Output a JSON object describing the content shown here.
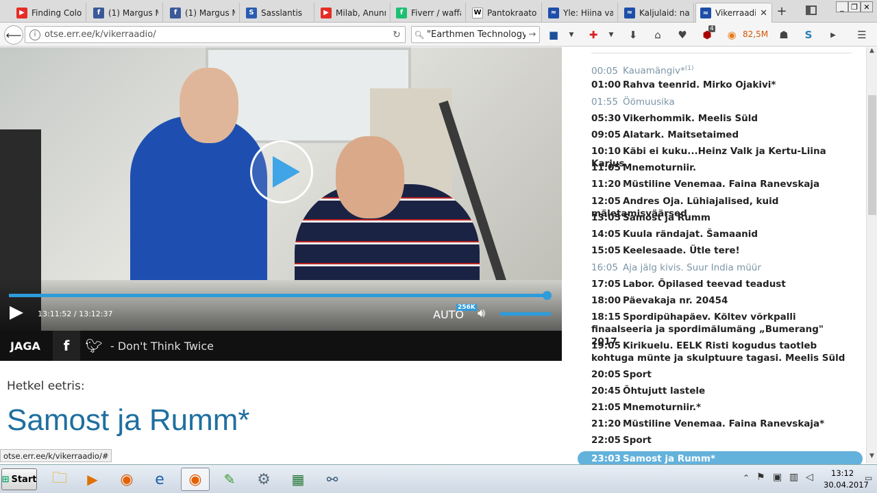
{
  "browser": {
    "tabs": [
      {
        "title": "Finding Colo",
        "fav_color": "#e52d27",
        "fav_glyph": "▶"
      },
      {
        "title": "(1) Margus M",
        "fav_color": "#3b5998",
        "fav_glyph": "f"
      },
      {
        "title": "(1) Margus M",
        "fav_color": "#3b5998",
        "fav_glyph": "f"
      },
      {
        "title": "Sasslantis",
        "fav_color": "#2a5db0",
        "fav_glyph": "S"
      },
      {
        "title": "Milab, Anunn",
        "fav_color": "#e52d27",
        "fav_glyph": "▶"
      },
      {
        "title": "Fiverr / waffa",
        "fav_color": "#1dbf73",
        "fav_glyph": "f"
      },
      {
        "title": "Pantokraator",
        "fav_color": "#ffffff",
        "fav_glyph": "W"
      },
      {
        "title": "Yle: Hiina val",
        "fav_color": "#1d4ea8",
        "fav_glyph": "≈"
      },
      {
        "title": "Kaljulaid: nai",
        "fav_color": "#1d4ea8",
        "fav_glyph": "≈"
      },
      {
        "title": "Vikerraadio",
        "fav_color": "#1d4ea8",
        "fav_glyph": "≈"
      }
    ],
    "new_tab": "+",
    "url": "otse.err.ee/k/vikerraadio/",
    "url_host": "err.ee",
    "search_query": "\"Earthmen Technology\"",
    "memory_badge": "82,5M",
    "addon_badge": "4"
  },
  "player": {
    "play_label": "▶",
    "time": "13:11:52 / 13:12:37",
    "quality": "AUTO",
    "bitrate": "256K",
    "progress": 0.999,
    "volume": 1.0,
    "share_label": "JAGA",
    "track": "- Don't Think Twice"
  },
  "now_playing": {
    "label": "Hetkel eetris:",
    "title": "Samost ja Rumm*"
  },
  "schedule": [
    {
      "time": "00:05",
      "title": "Kauamängiv*",
      "sup": "(1)",
      "state": "past"
    },
    {
      "time": "01:00",
      "title": "Rahva teenrid. Mirko Ojakivi*",
      "state": "future"
    },
    {
      "time": "01:55",
      "title": "Öömuusika",
      "state": "past"
    },
    {
      "time": "05:30",
      "title": "Vikerhommik. Meelis Süld",
      "state": "future"
    },
    {
      "time": "09:05",
      "title": "Alatark. Maitsetaimed",
      "state": "future"
    },
    {
      "time": "10:10",
      "title": "Käbi ei kuku...Heinz Valk ja Kertu-Liina Karjus",
      "state": "future"
    },
    {
      "time": "11:05",
      "title": "Mnemoturniir.",
      "state": "future"
    },
    {
      "time": "11:20",
      "title": "Müstiline Venemaa. Faina Ranevskaja",
      "state": "future"
    },
    {
      "time": "12:05",
      "title": "Andres Oja. Lühiajalised, kuid mäletamisväärsed",
      "state": "future"
    },
    {
      "time": "13:05",
      "title": "Samost ja Rumm",
      "state": "future"
    },
    {
      "time": "14:05",
      "title": "Kuula rändajat. Šamaanid",
      "state": "future"
    },
    {
      "time": "15:05",
      "title": "Keelesaade. Ütle tere!",
      "state": "future"
    },
    {
      "time": "16:05",
      "title": "Aja jälg kivis. Suur India müür",
      "state": "past"
    },
    {
      "time": "17:05",
      "title": "Labor. Õpilased teevad teadust",
      "state": "future"
    },
    {
      "time": "18:00",
      "title": "Päevakaja nr. 20454",
      "state": "future"
    },
    {
      "time": "18:15",
      "title": "Spordipühapäev. Költev võrkpalli finaalseeria ja spordimälumäng „Bumerang\" 2017",
      "state": "future"
    },
    {
      "time": "19:05",
      "title": "Kirikuelu. EELK Risti kogudus taotleb kohtuga münte ja skulptuure tagasi. Meelis Süld",
      "state": "future"
    },
    {
      "time": "20:05",
      "title": "Sport",
      "state": "future"
    },
    {
      "time": "20:45",
      "title": "Õhtujutt lastele",
      "state": "future"
    },
    {
      "time": "21:05",
      "title": "Mnemoturniir.*",
      "state": "future"
    },
    {
      "time": "21:20",
      "title": "Müstiline Venemaa. Faina Ranevskaja*",
      "state": "future"
    },
    {
      "time": "22:05",
      "title": "Sport",
      "state": "future"
    },
    {
      "time": "23:03",
      "title": "Samost ja Rumm*",
      "state": "current"
    }
  ],
  "status_link": "otse.err.ee/k/vikerraadio/#",
  "taskbar": {
    "start_label": "Start",
    "clock_time": "13:12",
    "clock_date": "30.04.2017"
  },
  "colors": {
    "accent_blue": "#2d9cdb",
    "share_bg": "#111111",
    "title_blue": "#1f6f9f",
    "current_row": "#63b2dc"
  }
}
